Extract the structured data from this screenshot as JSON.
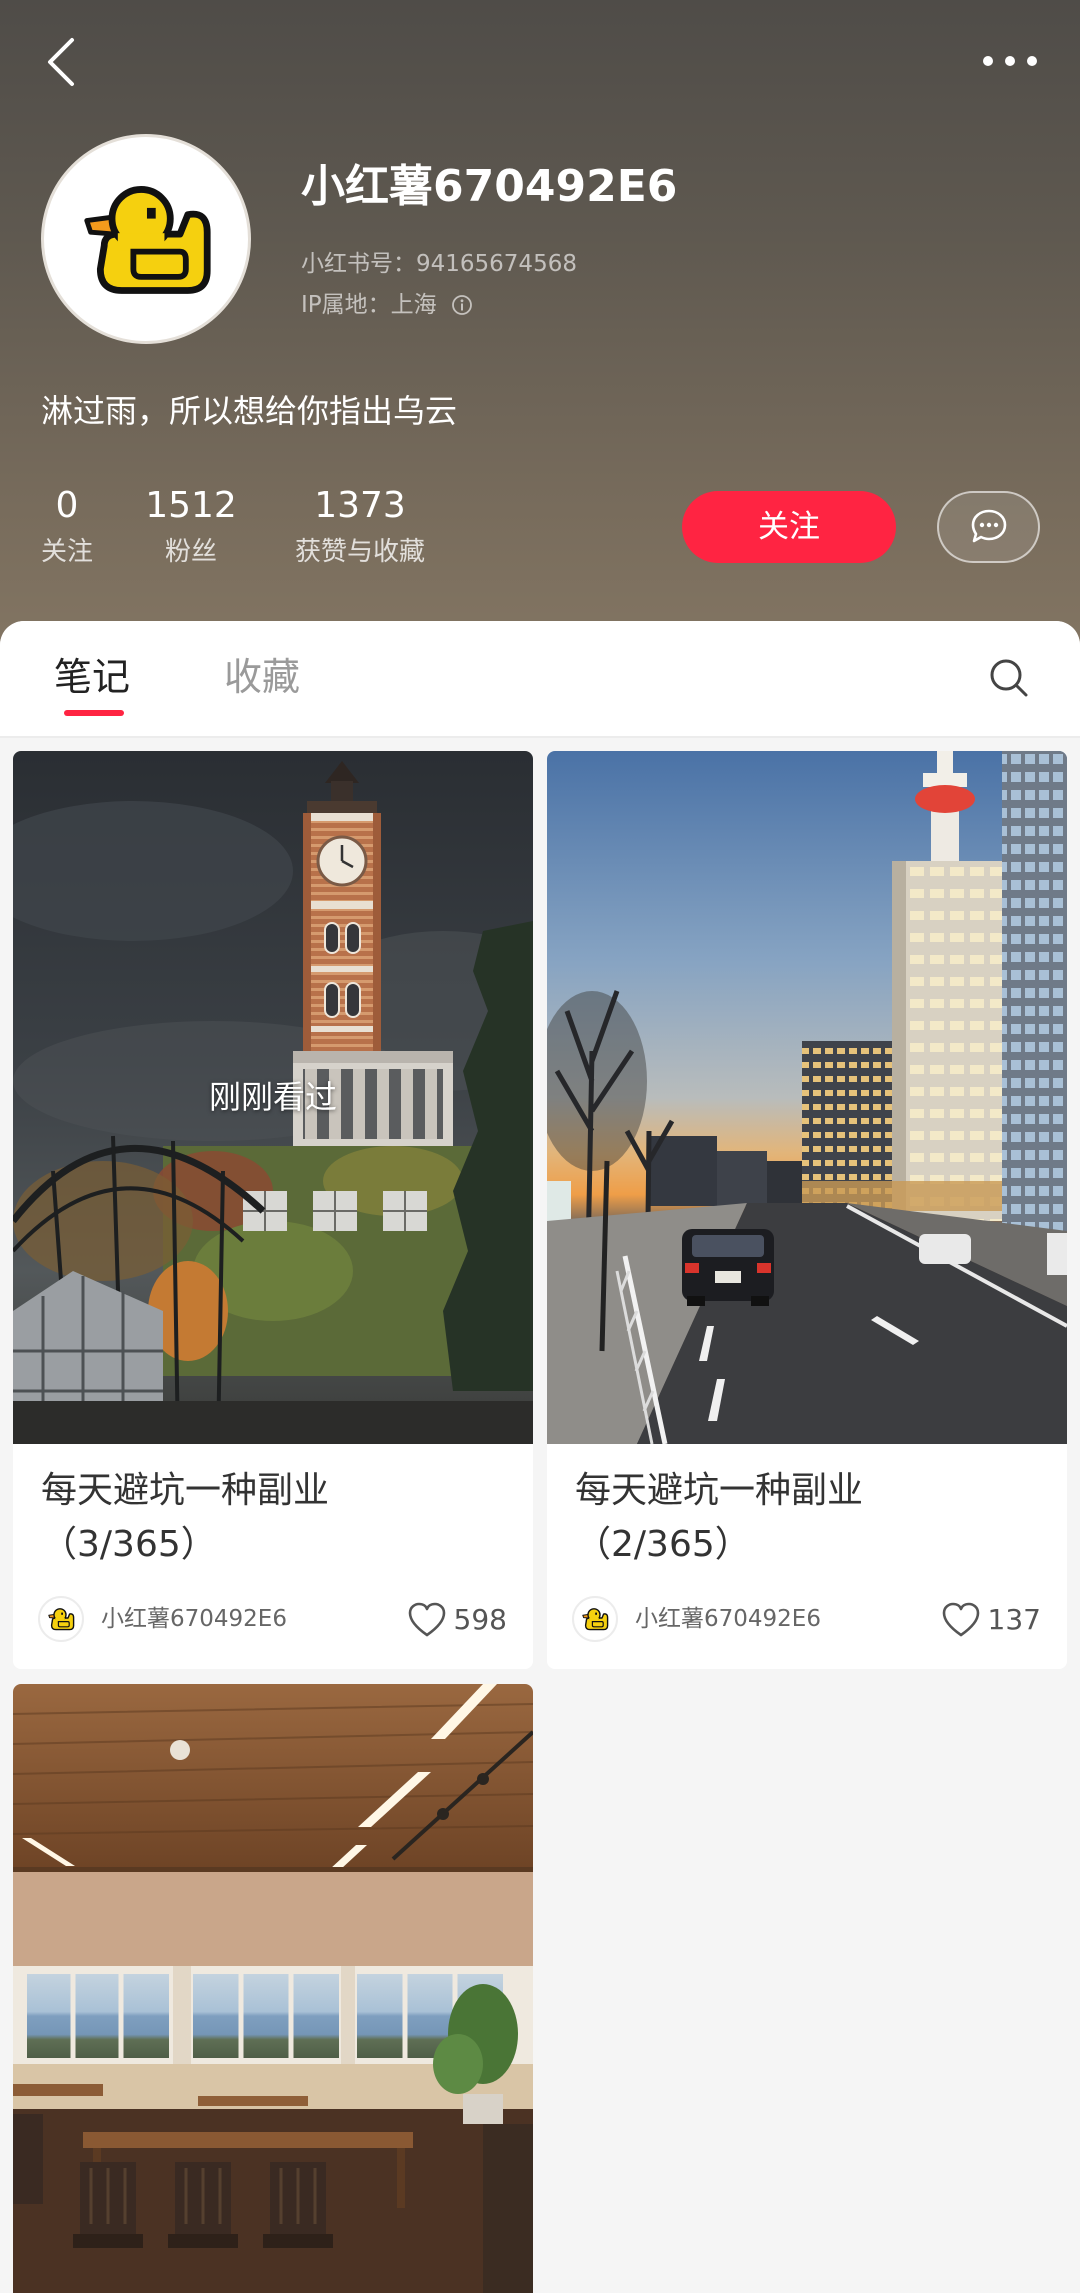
{
  "colors": {
    "accent": "#ff2442",
    "header_top": "#4f4c48",
    "header_bottom": "#857764"
  },
  "header": {
    "back_icon": "chevron-left-icon",
    "more_icon": "more-dots-icon"
  },
  "profile": {
    "avatar_icon": "duck-icon",
    "username": "小红薯670492E6",
    "red_id": "小红书号：94165674568",
    "ip_location": "IP属地：上海",
    "ip_info_icon": "info-icon",
    "bio": "淋过雨，所以想给你指出乌云"
  },
  "stats": [
    {
      "value": "0",
      "label": "关注"
    },
    {
      "value": "1512",
      "label": "粉丝"
    },
    {
      "value": "1373",
      "label": "获赞与收藏"
    }
  ],
  "actions": {
    "follow_label": "关注",
    "message_icon": "chat-bubble-icon"
  },
  "tabs": [
    {
      "label": "笔记",
      "active": true
    },
    {
      "label": "收藏",
      "active": false
    }
  ],
  "search_icon": "search-icon",
  "notes": [
    {
      "overlay": "刚刚看过",
      "title": "每天避坑一种副业",
      "title_line2": "（3/365）",
      "author": "小红薯670492E6",
      "like_icon": "heart-icon",
      "likes": "598"
    },
    {
      "title": "每天避坑一种副业",
      "title_line2": "（2/365）",
      "author": "小红薯670492E6",
      "like_icon": "heart-icon",
      "likes": "137"
    }
  ]
}
